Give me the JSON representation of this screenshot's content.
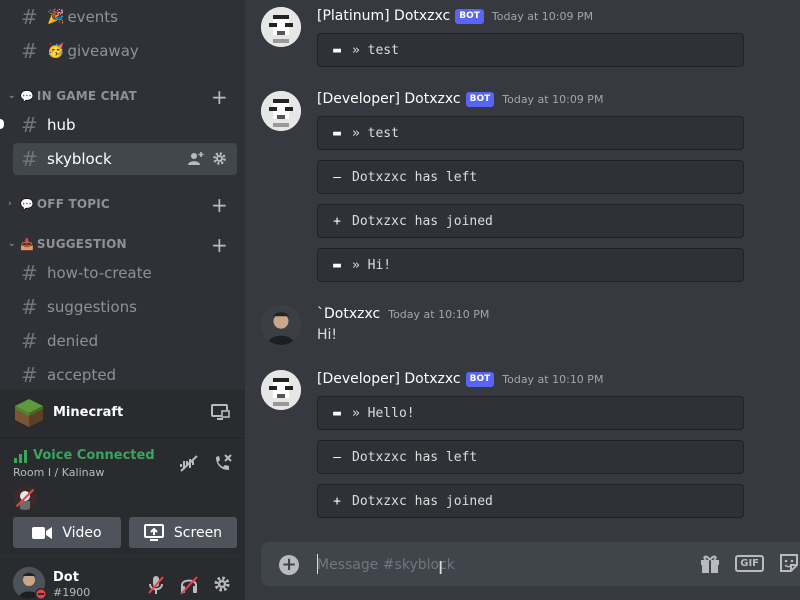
{
  "sidebar": {
    "channels_top": [
      {
        "name": "events",
        "emoji": "🎉"
      },
      {
        "name": "giveaway",
        "emoji": "🥳"
      }
    ],
    "category_ingame": {
      "label": "IN GAME CHAT",
      "emoji": "💬"
    },
    "ingame_channels": [
      {
        "name": "hub"
      },
      {
        "name": "skyblock"
      }
    ],
    "category_offtopic": {
      "label": "OFF TOPIC",
      "emoji": "💬"
    },
    "category_suggestion": {
      "label": "SUGGESTION",
      "emoji": "📥"
    },
    "suggestion_channels": [
      {
        "name": "how-to-create"
      },
      {
        "name": "suggestions"
      },
      {
        "name": "denied"
      },
      {
        "name": "accepted"
      }
    ]
  },
  "activity": {
    "name": "Minecraft"
  },
  "voice": {
    "status": "Voice Connected",
    "room": "Room I / Kalinaw",
    "video_label": "Video",
    "screen_label": "Screen"
  },
  "user": {
    "name": "Dot",
    "tag": "#1900"
  },
  "messages": [
    {
      "author": "[Platinum] Dotxzxc",
      "badge": "BOT",
      "time": "Today at 10:09 PM",
      "embeds": [
        "» test"
      ]
    },
    {
      "author": "[Developer] Dotxzxc",
      "badge": "BOT",
      "time": "Today at 10:09 PM",
      "embeds": [
        "» test",
        "Dotxzxc has left",
        "Dotxzxc has joined",
        "» Hi!"
      ]
    },
    {
      "author": "`Dotxzxc",
      "time": "Today at 10:10 PM",
      "text": "Hi!"
    },
    {
      "author": "[Developer] Dotxzxc",
      "badge": "BOT",
      "time": "Today at 10:10 PM",
      "embeds": [
        "» Hello!",
        "Dotxzxc has left",
        "Dotxzxc has joined"
      ]
    }
  ],
  "composer": {
    "placeholder": "Message #skyblock",
    "gif_label": "GIF"
  },
  "colors": {
    "accent": "#5865f2",
    "voice_green": "#3ba55d",
    "dnd_red": "#ed4245"
  }
}
